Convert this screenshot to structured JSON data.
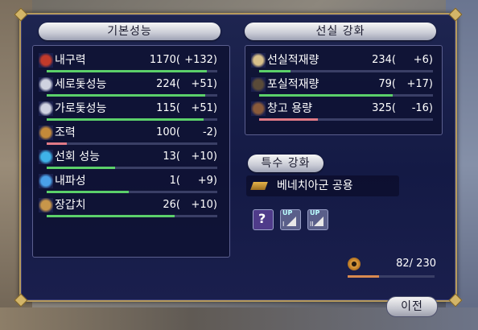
{
  "left_header": "기본성능",
  "right_header": "선실 강화",
  "special_header": "특수 강화",
  "left_stats": [
    {
      "label": "내구력",
      "value": "1170(",
      "delta": "+132)",
      "fill": 0.94,
      "color": "#5bd06a"
    },
    {
      "label": "세로돛성능",
      "value": "224(",
      "delta": "+51)",
      "fill": 0.93,
      "color": "#5bd06a"
    },
    {
      "label": "가로돛성능",
      "value": "115(",
      "delta": "+51)",
      "fill": 0.92,
      "color": "#5bd06a"
    },
    {
      "label": "조력",
      "value": "100(",
      "delta": "-2)",
      "fill": 0.12,
      "color": "#e07a86"
    },
    {
      "label": "선회 성능",
      "value": "13(",
      "delta": "+10)",
      "fill": 0.4,
      "color": "#5bd06a"
    },
    {
      "label": "내파성",
      "value": "1(",
      "delta": "+9)",
      "fill": 0.48,
      "color": "#5bd06a"
    },
    {
      "label": "장갑치",
      "value": "26(",
      "delta": "+10)",
      "fill": 0.75,
      "color": "#5bd06a"
    }
  ],
  "right_stats": [
    {
      "label": "선실적재량",
      "value": "234(",
      "delta": "+6)",
      "fill": 0.18,
      "color": "#5bd06a"
    },
    {
      "label": "포실적재량",
      "value": "79(",
      "delta": "+17)",
      "fill": 0.77,
      "color": "#5bd06a"
    },
    {
      "label": "창고 용량",
      "value": "325(",
      "delta": "-16)",
      "fill": 0.34,
      "color": "#e07a86"
    }
  ],
  "special_item": "베네치아군 공용",
  "slot_icons": [
    "question-slot-icon",
    "upgrade-slot-1-icon",
    "upgrade-slot-2-icon"
  ],
  "slot_labels": {
    "up1": "UP",
    "up2": "UP",
    "roman1": "I",
    "roman2": "II",
    "question": "?"
  },
  "capacity": {
    "value": "82/ 230",
    "fill": 0.36
  },
  "next_button": "이전"
}
